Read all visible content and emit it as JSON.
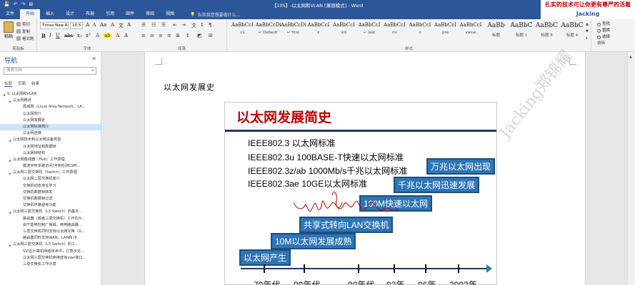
{
  "window": {
    "title": "【105】-以太网和VLAN [兼容模式] - Word",
    "qat": [
      "💾",
      "↶",
      "↷",
      "⊞"
    ]
  },
  "watermark_top": {
    "line1": "扎实的技术可让你更有尊严的活着",
    "line2": "Jacking"
  },
  "tabs": [
    "文件",
    "开始",
    "插入",
    "设计",
    "布局",
    "引用",
    "邮件",
    "审阅",
    "视图"
  ],
  "tell_me": "告诉我您想要做什么...",
  "ribbon": {
    "clipboard": {
      "paste": "粘贴",
      "cut": "剪切",
      "copy": "复制",
      "format": "格式刷",
      "label": "剪贴板"
    },
    "font": {
      "name": "Times New R",
      "size": "10.5",
      "label": "字体"
    },
    "paragraph_label": "段落",
    "styles": [
      {
        "preview": "AaBbCcI",
        "name": "c1"
      },
      {
        "preview": "AaBbCcDi",
        "name": "↵ Default"
      },
      {
        "preview": "AaBbCcDi",
        "name": "↵ first"
      },
      {
        "preview": "AaBbCcI",
        "name": "k"
      },
      {
        "preview": "AaBbCcI",
        "name": "kd"
      },
      {
        "preview": "AaBbCcI",
        "name": "↵ last"
      },
      {
        "preview": "AaBbCcI",
        "name": "mi"
      },
      {
        "preview": "AaBbCcI",
        "name": "o"
      },
      {
        "preview": "AaBbCcI",
        "name": "pre"
      },
      {
        "preview": "AaBbCcI",
        "name": "value"
      },
      {
        "preview": "AaBb",
        "name": "标题"
      },
      {
        "preview": "AaBbC",
        "name": "标题 1"
      },
      {
        "preview": "AaBbC",
        "name": "标题 3"
      },
      {
        "preview": "AaBbC",
        "name": "标题 4"
      }
    ],
    "styles_label": "样式",
    "editing": {
      "find": "查找",
      "replace": "替换",
      "select": "选择",
      "label": "编辑"
    }
  },
  "nav": {
    "title": "导航",
    "search_placeholder": "搜索文档",
    "tabs": [
      "标题",
      "页面",
      "结果"
    ],
    "items": [
      {
        "t": "5. 以太网和VLAN",
        "lvl": 0
      },
      {
        "t": "以太网概述",
        "lvl": 1
      },
      {
        "t": "局域网（Local Area Network，LA...",
        "lvl": 2
      },
      {
        "t": "以太网简介",
        "lvl": 2
      },
      {
        "t": "以太网发展史",
        "lvl": 2
      },
      {
        "t": "以太网标准简介",
        "lvl": 2,
        "sel": true
      },
      {
        "t": "以太网连接",
        "lvl": 2
      },
      {
        "t": "以太网技术和以太网设备类型",
        "lvl": 1
      },
      {
        "t": "以太网地址和数据帧",
        "lvl": 2
      },
      {
        "t": "以太网帧结构",
        "lvl": 2
      },
      {
        "t": "以太网集线器（Hub）工作原理",
        "lvl": 1
      },
      {
        "t": "载波侦听多路访问/冲突检测CSM...",
        "lvl": 2
      },
      {
        "t": "以太网二层交换机（Switch）工作原理",
        "lvl": 1
      },
      {
        "t": "以太网二层交换机简介",
        "lvl": 2
      },
      {
        "t": "交换机动态地址学习",
        "lvl": 2
      },
      {
        "t": "交换机数据帧转发",
        "lvl": 2
      },
      {
        "t": "交换机数据帧过滤",
        "lvl": 2
      },
      {
        "t": "交换机环路避免功能",
        "lvl": 2
      },
      {
        "t": "以太网三层交换机（L3 Switch）的基本...",
        "lvl": 1
      },
      {
        "t": "路由器（或者三层交换机）工作在O...",
        "lvl": 2
      },
      {
        "t": "由于能够控制广播域，使用路由器...",
        "lvl": 2
      },
      {
        "t": "三层交换机同时支持以太网交换（O...",
        "lvl": 2
      },
      {
        "t": "路由器同时支持WAN、LAN和 IP...",
        "lvl": 2
      },
      {
        "t": "以太网三层交换机（L3 Switch）的工...",
        "lvl": 1
      },
      {
        "t": "SVI在计算机网络技术中，它表示交...",
        "lvl": 2
      },
      {
        "t": "以太网三层交换机使用虚拟vlan接口...",
        "lvl": 2
      },
      {
        "t": "三层交换机工作示意",
        "lvl": 2
      }
    ]
  },
  "doc": {
    "heading": "以太网发展史"
  },
  "slide": {
    "title": "以太网发展简史",
    "bullets": [
      "IEEE802.3 以太网标准",
      "IEEE802.3u 100BASE-T快速以太网标准",
      "IEEE802.3z/ab 1000Mb/s千兆以太网标准",
      "IEEE802.3ae 10GE以太网标准"
    ],
    "callouts": [
      "万兆以太网出现",
      "千兆以太网迅速发展",
      "100M快速以太网",
      "共享式转向LAN交换机",
      "10M以太网发展成熟",
      "以太网产生"
    ],
    "years": [
      "70年代",
      "80年代",
      "90年代",
      "92年",
      "96年",
      "2002年"
    ]
  },
  "watermark_doc": "Jacking郑锦耀",
  "colors": {
    "brand": "#2b579a",
    "title_red": "#c00000",
    "callout": "#2e75b6",
    "scribble": "#c00000"
  }
}
